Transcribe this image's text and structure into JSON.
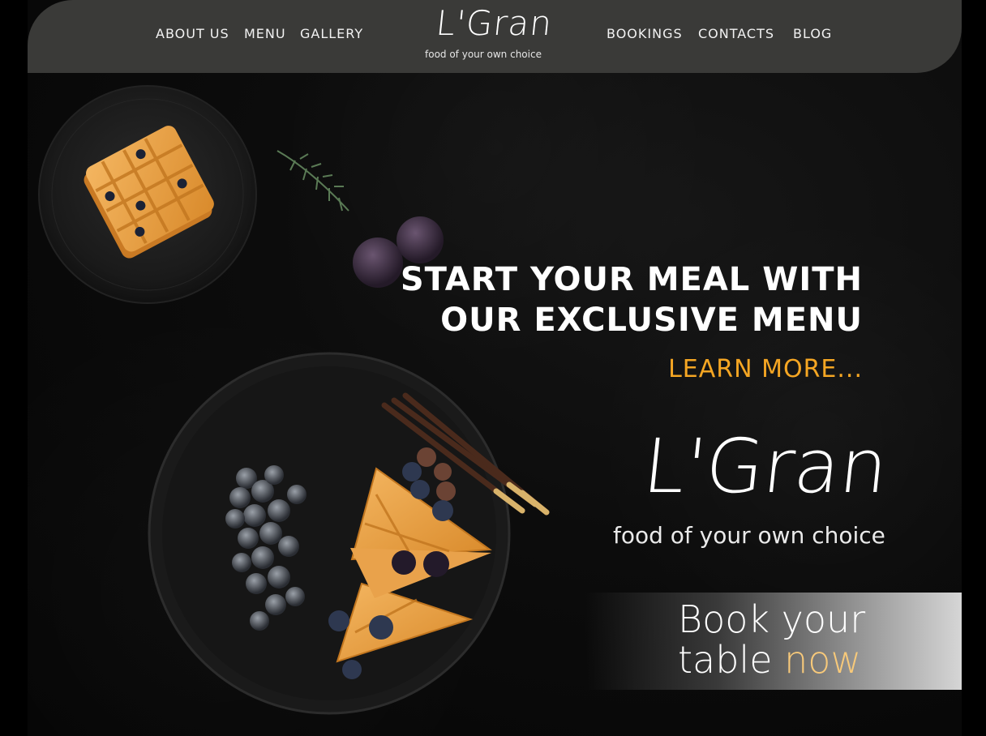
{
  "nav": {
    "left": [
      "ABOUT US",
      "MENU",
      "GALLERY"
    ],
    "right": [
      "BOOKINGS",
      "CONTACTS",
      "BLOG"
    ]
  },
  "logo": {
    "title": "L'Gran",
    "tagline": "food of your own choice"
  },
  "hero": {
    "line1": "START YOUR MEAL WITH",
    "line2": "OUR EXCLUSIVE MENU",
    "cta": "LEARN MORE..."
  },
  "brand": {
    "title": "L'Gran",
    "tagline": "food of your own choice"
  },
  "booking": {
    "line1": "Book your",
    "line2_prefix": "table",
    "line2_highlight": "now"
  },
  "colors": {
    "header_bg": "#3a3a38",
    "accent": "#f5a623",
    "highlight": "#f7c97a",
    "background": "#0a0a0a"
  },
  "icons": [
    "waffle-plate-image",
    "rosemary-image",
    "plums-image",
    "grapes-waffle-plate-image"
  ]
}
